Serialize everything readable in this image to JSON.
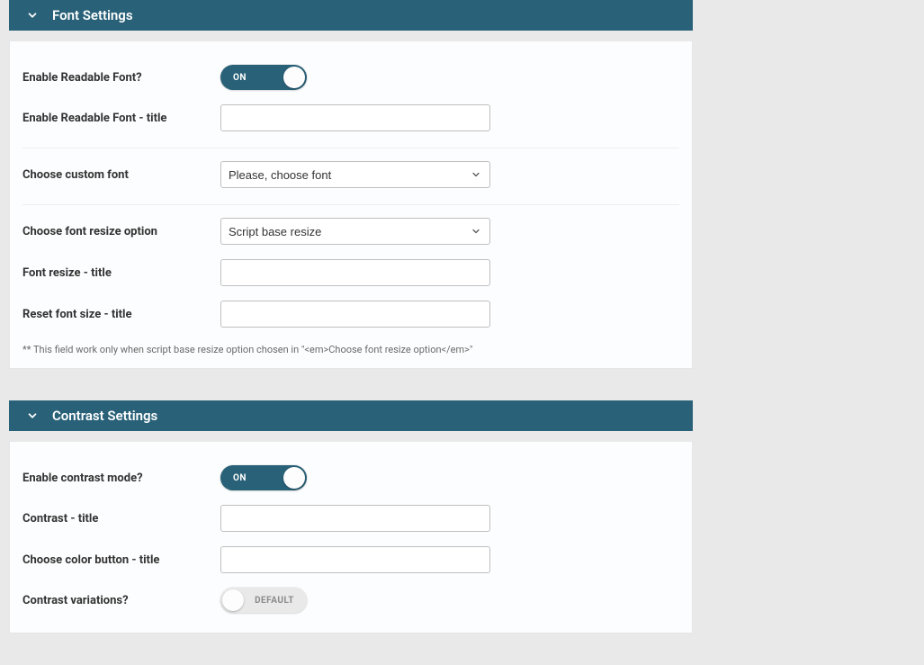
{
  "sections": {
    "font": {
      "title": "Font Settings",
      "fields": {
        "enable_readable_label": "Enable Readable Font?",
        "enable_readable_state": "ON",
        "enable_readable_title_label": "Enable Readable Font - title",
        "enable_readable_title_value": "",
        "choose_custom_font_label": "Choose custom font",
        "choose_custom_font_value": "Please, choose font",
        "choose_resize_option_label": "Choose font resize option",
        "choose_resize_option_value": "Script base resize",
        "font_resize_title_label": "Font resize - title",
        "font_resize_title_value": "",
        "reset_font_size_title_label": "Reset font size - title",
        "reset_font_size_title_value": ""
      },
      "footnote": "** This field work only when script base resize option chosen in \"<em>Choose font resize option</em>\""
    },
    "contrast": {
      "title": "Contrast Settings",
      "fields": {
        "enable_contrast_label": "Enable contrast mode?",
        "enable_contrast_state": "ON",
        "contrast_title_label": "Contrast - title",
        "contrast_title_value": "",
        "choose_color_button_title_label": "Choose color button - title",
        "choose_color_button_title_value": "",
        "contrast_variations_label": "Contrast variations?",
        "contrast_variations_state": "DEFAULT"
      }
    }
  }
}
